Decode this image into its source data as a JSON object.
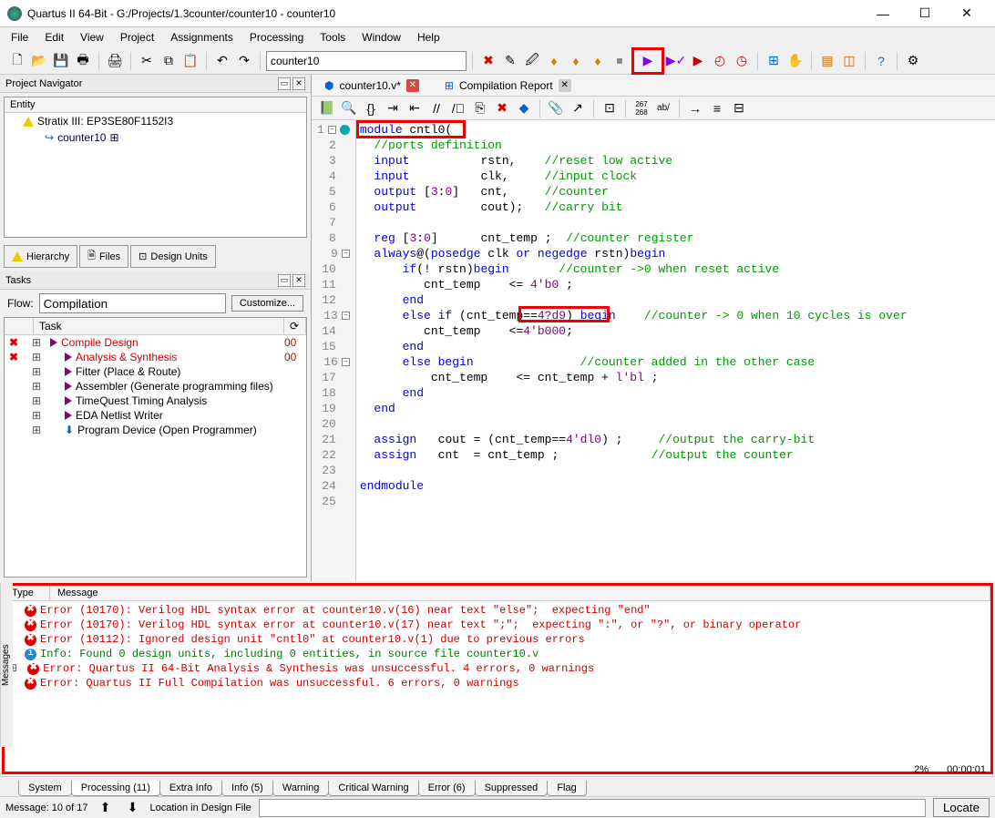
{
  "window": {
    "title": "Quartus II 64-Bit - G:/Projects/1.3counter/counter10 - counter10",
    "minimize": "—",
    "maximize": "☐",
    "close": "✕"
  },
  "menus": [
    "File",
    "Edit",
    "View",
    "Project",
    "Assignments",
    "Processing",
    "Tools",
    "Window",
    "Help"
  ],
  "toolbar_project": "counter10",
  "panel": {
    "pn_title": "Project Navigator",
    "entity_hdr": "Entity",
    "device": "Stratix III: EP3SE80F1152I3",
    "top": "counter10",
    "tabs": [
      "Hierarchy",
      "Files",
      "Design Units"
    ],
    "tasks_title": "Tasks",
    "flow_label": "Flow:",
    "flow_value": "Compilation",
    "customize": "Customize...",
    "task_hdr": "Task",
    "tasks": [
      {
        "st": "x",
        "name": "Compile Design",
        "pct": "00",
        "red": true,
        "indent": 0
      },
      {
        "st": "x",
        "name": "Analysis & Synthesis",
        "pct": "00",
        "red": true,
        "indent": 1
      },
      {
        "st": "",
        "name": "Fitter (Place & Route)",
        "pct": "",
        "indent": 1
      },
      {
        "st": "",
        "name": "Assembler (Generate programming files)",
        "pct": "",
        "indent": 1
      },
      {
        "st": "",
        "name": "TimeQuest Timing Analysis",
        "pct": "",
        "indent": 1
      },
      {
        "st": "",
        "name": "EDA Netlist Writer",
        "pct": "",
        "indent": 1
      },
      {
        "st": "",
        "name": "Program Device (Open Programmer)",
        "pct": "",
        "indent": 1,
        "prog": true
      }
    ]
  },
  "editor": {
    "tab1": "counter10.v*",
    "tab2": "Compilation Report",
    "lines": [
      {
        "n": 1,
        "fold": "-",
        "html": "<span class='kw'>module</span> cntl0("
      },
      {
        "n": 2,
        "html": "  <span class='cm'>//ports definition</span>"
      },
      {
        "n": 3,
        "html": "  <span class='kw'>input</span>          rstn,    <span class='cm'>//reset low active</span>"
      },
      {
        "n": 4,
        "html": "  <span class='kw'>input</span>          clk,     <span class='cm'>//input clock</span>"
      },
      {
        "n": 5,
        "html": "  <span class='kw'>output</span> [<span class='num'>3</span>:<span class='num'>0</span>]   cnt,     <span class='cm'>//counter</span>"
      },
      {
        "n": 6,
        "html": "  <span class='kw'>output</span>         cout);   <span class='cm'>//carry bit</span>"
      },
      {
        "n": 7,
        "html": ""
      },
      {
        "n": 8,
        "html": "  <span class='kw'>reg</span> [<span class='num'>3</span>:<span class='num'>0</span>]      cnt_temp ;  <span class='cm'>//counter register</span>"
      },
      {
        "n": 9,
        "fold": "-",
        "html": "  <span class='kw'>always</span>@(<span class='kw'>posedge</span> clk <span class='kw'>or</span> <span class='kw'>negedge</span> rstn)<span class='kw'>begin</span>"
      },
      {
        "n": 10,
        "html": "      <span class='kw'>if</span>(! rstn)<span class='kw'>begin</span>       <span class='cm'>//counter -&gt;0 when reset active</span>"
      },
      {
        "n": 11,
        "html": "         cnt_temp    &lt;= <span class='num'>4'b0</span> ;"
      },
      {
        "n": 12,
        "html": "      <span class='kw'>end</span>"
      },
      {
        "n": 13,
        "fold": "-",
        "html": "      <span class='kw'>else if</span> (cnt_temp==<span class='num'>4?d9</span>) <span class='kw'>begin</span>    <span class='cm'>//counter -&gt; 0 when 10 cycles is over</span>"
      },
      {
        "n": 14,
        "html": "         cnt_temp    &lt;=<span class='num'>4'b000</span>;"
      },
      {
        "n": 15,
        "html": "      <span class='kw'>end</span>"
      },
      {
        "n": 16,
        "fold": "-",
        "html": "      <span class='kw'>else begin</span>               <span class='cm'>//counter added in the other case</span>"
      },
      {
        "n": 17,
        "html": "          cnt_temp    &lt;= cnt_temp + <span class='num'>l'bl</span> ;"
      },
      {
        "n": 18,
        "html": "      <span class='kw'>end</span>"
      },
      {
        "n": 19,
        "html": "  <span class='kw'>end</span>"
      },
      {
        "n": 20,
        "html": ""
      },
      {
        "n": 21,
        "html": "  <span class='kw'>assign</span>   cout = (cnt_temp==<span class='num'>4'dl0</span>) ;     <span class='cm'>//output the carry-bit</span>"
      },
      {
        "n": 22,
        "html": "  <span class='kw'>assign</span>   cnt  = cnt_temp ;             <span class='cm'>//output the counter</span>"
      },
      {
        "n": 23,
        "html": ""
      },
      {
        "n": 24,
        "html": "<span class='kw'>endmodule</span>"
      },
      {
        "n": 25,
        "html": ""
      }
    ]
  },
  "messages": {
    "hdr_type": "Type",
    "hdr_msg": "Message",
    "rows": [
      {
        "t": "err",
        "txt": "Error (10170): Verilog HDL syntax error at counter10.v(16) near text \"else\";  expecting \"end\""
      },
      {
        "t": "err",
        "txt": "Error (10170): Verilog HDL syntax error at counter10.v(17) near text \";\";  expecting \":\", or \"?\", or binary operator"
      },
      {
        "t": "err",
        "txt": "Error (10112): Ignored design unit \"cntl0\" at counter10.v(1) due to previous errors"
      },
      {
        "t": "inf",
        "txt": "Info: Found 0 design units, including 0 entities, in source file counter10.v"
      },
      {
        "t": "err",
        "txt": "Error: Quartus II 64-Bit Analysis & Synthesis was unsuccessful. 4 errors, 0 warnings",
        "exp": true
      },
      {
        "t": "err",
        "txt": "Error: Quartus II Full Compilation was unsuccessful. 6 errors, 0 warnings"
      }
    ],
    "tabs": [
      "System",
      "Processing (11)",
      "Extra Info",
      "Info (5)",
      "Warning",
      "Critical Warning",
      "Error (6)",
      "Suppressed",
      "Flag"
    ],
    "status": "Message: 10 of 17",
    "loc_label": "Location in Design File",
    "locate": "Locate",
    "side": "Messages"
  },
  "statusbar": {
    "pct": "2%",
    "time": "00:00:01"
  }
}
